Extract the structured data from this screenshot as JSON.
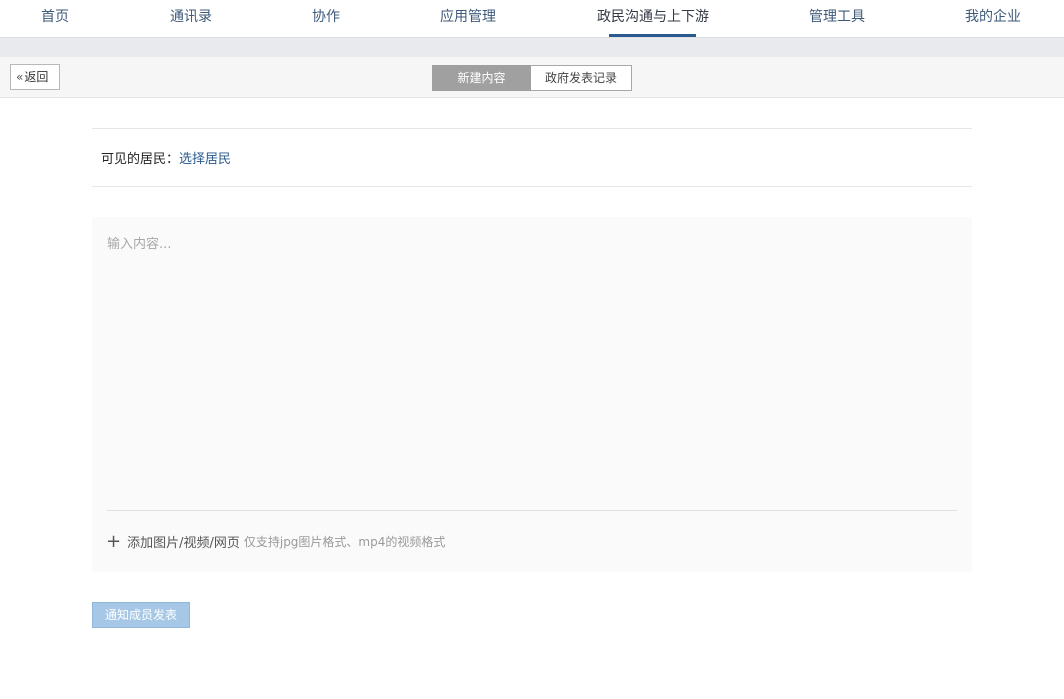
{
  "nav": {
    "items": [
      {
        "label": "首页"
      },
      {
        "label": "通讯录"
      },
      {
        "label": "协作"
      },
      {
        "label": "应用管理"
      },
      {
        "label": "政民沟通与上下游",
        "active": true
      },
      {
        "label": "管理工具"
      },
      {
        "label": "我的企业"
      }
    ]
  },
  "toolbar": {
    "back_label": "返回",
    "back_icon": "double-chevron-left-icon",
    "tabs": [
      {
        "label": "新建内容",
        "active": true
      },
      {
        "label": "政府发表记录",
        "active": false
      }
    ]
  },
  "form": {
    "visible_label": "可见的居民：",
    "select_link": "选择居民",
    "content_placeholder": "输入内容...",
    "attach_icon": "plus-icon",
    "attach_label": "添加图片/视频/网页",
    "attach_hint": "仅支持jpg图片格式、mp4的视频格式",
    "submit_label": "通知成员发表"
  },
  "colors": {
    "nav_text": "#3e5a7a",
    "nav_underline": "#2a5a8f",
    "link": "#2a5a8f",
    "segment_active_bg": "#a0a0a0",
    "submit_bg": "#a6c8e6"
  }
}
